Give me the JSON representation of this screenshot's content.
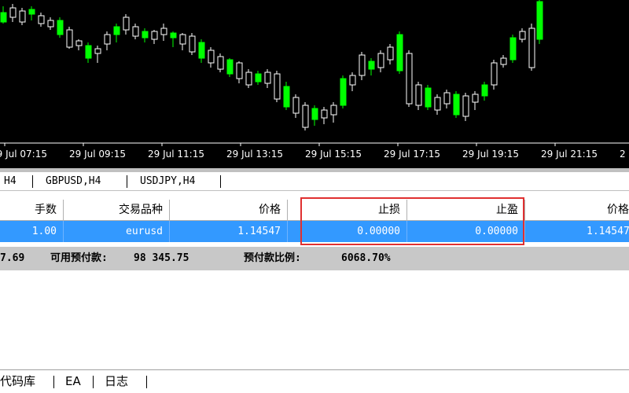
{
  "chart": {
    "background": "#000000",
    "bull_color": "#ffffff",
    "bear_color": "#00ff00",
    "time_labels": [
      "29 Jul 07:15",
      "29 Jul 09:15",
      "29 Jul 11:15",
      "29 Jul 13:15",
      "29 Jul 15:15",
      "29 Jul 17:15",
      "29 Jul 19:15",
      "29 Jul 21:15",
      "2"
    ]
  },
  "chart_tabs": [
    {
      "label": "H4"
    },
    {
      "label": "GBPUSD,H4"
    },
    {
      "label": "USDJPY,H4"
    }
  ],
  "table": {
    "headers": [
      "手数",
      "交易品种",
      "价格",
      "止损",
      "止盈",
      "价格"
    ],
    "row": [
      "1.00",
      "eurusd",
      "1.14547",
      "0.00000",
      "0.00000",
      "1.14547"
    ],
    "selected_row_color": "#3399ff",
    "highlight_color": "#e03030"
  },
  "summary": {
    "balance_fragment": "7.69",
    "free_margin_label": "可用预付款:",
    "free_margin_value": "98 345.75",
    "margin_level_label": "预付款比例:",
    "margin_level_value": "6068.70%"
  },
  "bottom_tabs": [
    {
      "label": "代码库"
    },
    {
      "label": "EA"
    },
    {
      "label": "日志"
    }
  ]
}
